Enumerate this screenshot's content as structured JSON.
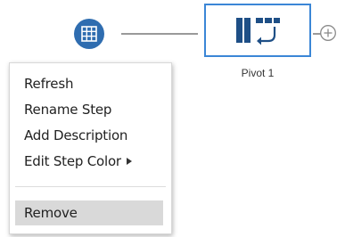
{
  "flow": {
    "input_node": {
      "icon": "table-grid-icon",
      "color": "#2f6db0"
    },
    "pivot_step": {
      "label": "Pivot 1",
      "icon": "pivot-icon",
      "border_color": "#3b86d6",
      "icon_color": "#1e4f86",
      "selected": true
    },
    "add_step": {
      "icon": "plus-circle-icon"
    }
  },
  "context_menu": {
    "items": [
      {
        "label": "Refresh"
      },
      {
        "label": "Rename Step"
      },
      {
        "label": "Add Description"
      },
      {
        "label": "Edit Step Color",
        "has_submenu": true,
        "submenu_icon": "chevron-right-icon"
      },
      {
        "label": "Remove",
        "highlighted": true
      }
    ]
  }
}
